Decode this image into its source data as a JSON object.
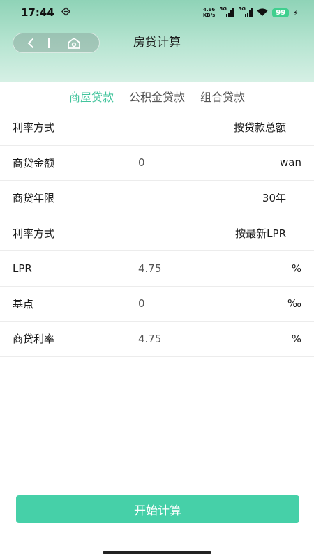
{
  "status": {
    "time": "17:44",
    "net_speed_value": "4.66",
    "net_speed_unit": "KB/s",
    "sim1": "5G",
    "sim2": "5G",
    "battery": "99"
  },
  "header": {
    "title": "房贷计算"
  },
  "tabs": [
    {
      "label": "商屋贷款",
      "active": true
    },
    {
      "label": "公积金贷款",
      "active": false
    },
    {
      "label": "组合贷款",
      "active": false
    }
  ],
  "rows": {
    "rate_method_1": {
      "label": "利率方式",
      "selected": "按贷款总额"
    },
    "loan_amount": {
      "label": "商贷金额",
      "value": "0",
      "unit": "wan"
    },
    "loan_years": {
      "label": "商贷年限",
      "selected": "30年"
    },
    "rate_method_2": {
      "label": "利率方式",
      "selected": "按最新LPR"
    },
    "lpr": {
      "label": "LPR",
      "value": "4.75",
      "unit": "%"
    },
    "basis_points": {
      "label": "基点",
      "value": "0",
      "unit": "‰"
    },
    "loan_rate": {
      "label": "商贷利率",
      "value": "4.75",
      "unit": "%"
    }
  },
  "actions": {
    "calculate_label": "开始计算"
  },
  "colors": {
    "accent": "#41c49c",
    "button": "#46d0a8",
    "battery": "#3fcf8e"
  }
}
